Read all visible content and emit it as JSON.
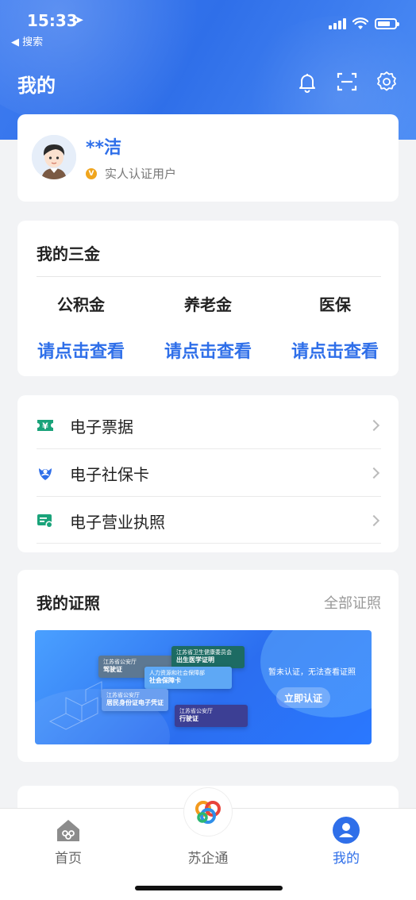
{
  "status": {
    "time": "15:33",
    "back_label": "◀ 搜索"
  },
  "header": {
    "title": "我的"
  },
  "profile": {
    "name": "**洁",
    "badge": "V",
    "verify_text": "实人认证用户"
  },
  "funds": {
    "title": "我的三金",
    "items": [
      {
        "name": "公积金",
        "link": "请点击查看"
      },
      {
        "name": "养老金",
        "link": "请点击查看"
      },
      {
        "name": "医保",
        "link": "请点击查看"
      }
    ]
  },
  "documents": {
    "items": [
      {
        "label": "电子票据",
        "icon": "ticket-icon"
      },
      {
        "label": "电子社保卡",
        "icon": "social-security-icon"
      },
      {
        "label": "电子营业执照",
        "icon": "license-icon"
      }
    ]
  },
  "certificates": {
    "title": "我的证照",
    "all_label": "全部证照",
    "banner": {
      "message": "暂未认证，无法查看证照",
      "button": "立即认证",
      "cards": [
        {
          "issuer": "江苏省公安厅",
          "name": "驾驶证"
        },
        {
          "issuer": "江苏省卫生健康委员会",
          "name": "出生医学证明"
        },
        {
          "issuer": "人力资源和社会保障部",
          "name": "社会保障卡"
        },
        {
          "issuer": "江苏省公安厅",
          "name": "居民身份证电子凭证"
        },
        {
          "issuer": "江苏省公安厅",
          "name": "行驶证"
        }
      ]
    }
  },
  "tabbar": {
    "items": [
      {
        "label": "首页"
      },
      {
        "label": "苏企通"
      },
      {
        "label": "我的"
      }
    ]
  },
  "colors": {
    "primary": "#2f6fe9",
    "background": "#f2f3f5",
    "badge": "#f0a51d"
  }
}
